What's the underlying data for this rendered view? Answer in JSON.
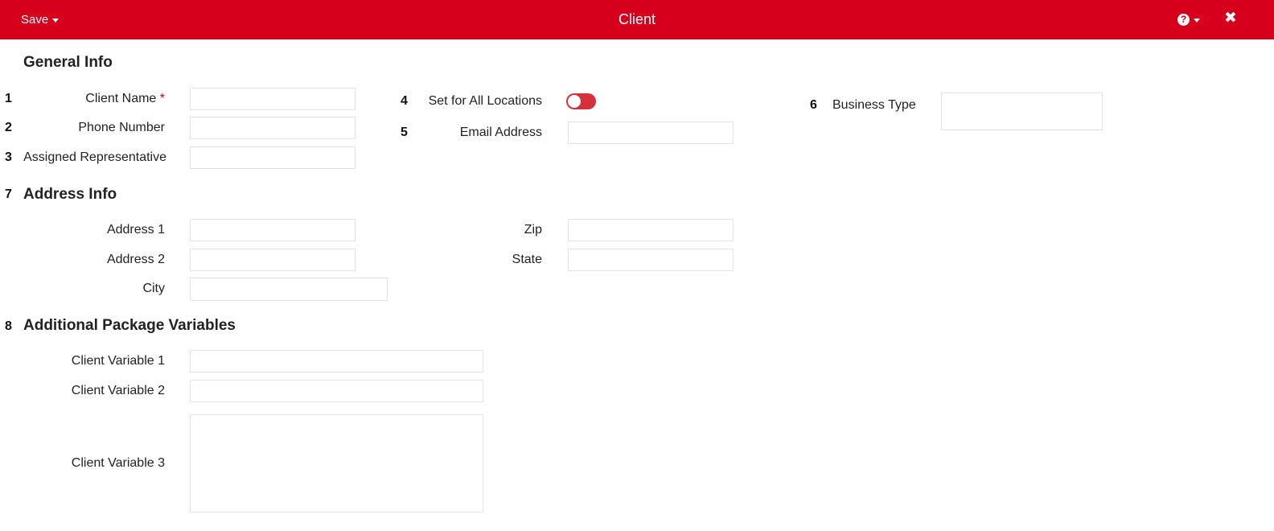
{
  "header": {
    "save_label": "Save",
    "title": "Client",
    "help_glyph": "?",
    "close_glyph": "✖",
    "icons": [
      "caret-down-icon",
      "help-icon",
      "close-icon"
    ],
    "bar_color": "#d6001c"
  },
  "general": {
    "title": "General Info",
    "client_name": {
      "num": "1",
      "label": "Client Name",
      "required": "*",
      "value": ""
    },
    "phone": {
      "num": "2",
      "label": "Phone Number",
      "value": ""
    },
    "rep": {
      "num": "3",
      "label": "Assigned Representative",
      "value": ""
    },
    "all_locations": {
      "num": "4",
      "label": "Set for All Locations",
      "toggle_color": "#d6303a"
    },
    "email": {
      "num": "5",
      "label": "Email Address",
      "value": ""
    },
    "business": {
      "num": "6",
      "label": "Business Type",
      "value": ""
    }
  },
  "address": {
    "num": "7",
    "title": "Address Info",
    "address1": {
      "label": "Address 1",
      "value": ""
    },
    "address2": {
      "label": "Address 2",
      "value": ""
    },
    "city": {
      "label": "City",
      "value": ""
    },
    "zip": {
      "label": "Zip",
      "value": ""
    },
    "state": {
      "label": "State",
      "value": ""
    }
  },
  "package": {
    "num": "8",
    "title": "Additional Package Variables",
    "var1": {
      "label": "Client Variable 1",
      "value": ""
    },
    "var2": {
      "label": "Client Variable 2",
      "value": ""
    },
    "var3": {
      "label": "Client Variable 3",
      "value": ""
    }
  }
}
